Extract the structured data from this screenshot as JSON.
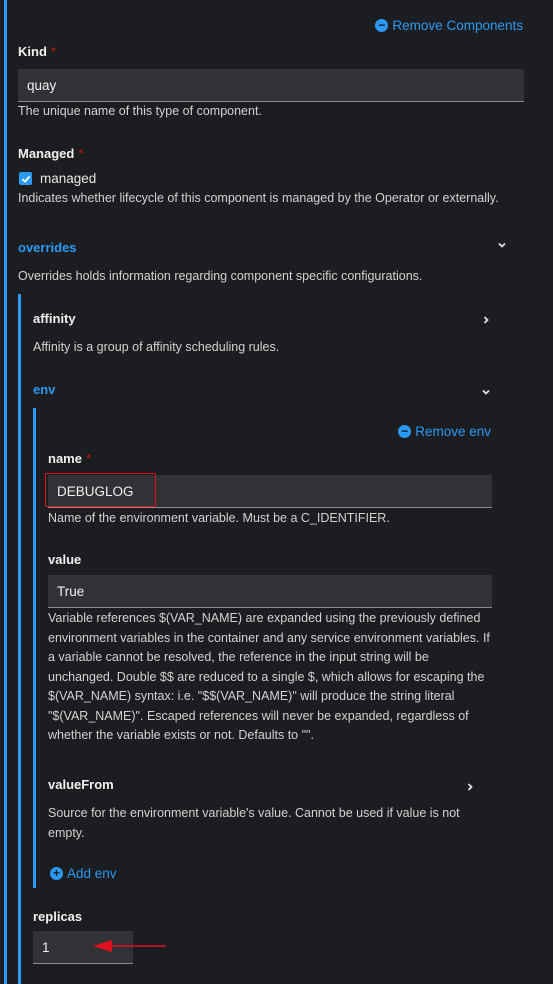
{
  "remove_components_label": "Remove Components",
  "kind": {
    "label": "Kind",
    "required": "*",
    "value": "quay",
    "help": "The unique name of this type of component."
  },
  "managed": {
    "label": "Managed",
    "required": "*",
    "checkbox_label": "managed",
    "checked": true,
    "help": "Indicates whether lifecycle of this component is managed by the Operator or externally."
  },
  "overrides": {
    "label": "overrides",
    "help": "Overrides holds information regarding component specific configurations.",
    "affinity": {
      "label": "affinity",
      "help": "Affinity is a group of affinity scheduling rules."
    },
    "env": {
      "label": "env",
      "remove_label": "Remove env",
      "name": {
        "label": "name",
        "required": "*",
        "value": "DEBUGLOG",
        "help": "Name of the environment variable. Must be a C_IDENTIFIER."
      },
      "value": {
        "label": "value",
        "value": "True",
        "help": "Variable references $(VAR_NAME) are expanded using the previously defined environment variables in the container and any service environment variables. If a variable cannot be resolved, the reference in the input string will be unchanged. Double $$ are reduced to a single $, which allows for escaping the $(VAR_NAME) syntax: i.e. \"$$(VAR_NAME)\" will produce the string literal \"$(VAR_NAME)\". Escaped references will never be expanded, regardless of whether the variable exists or not. Defaults to \"\"."
      },
      "value_from": {
        "label": "valueFrom",
        "help": "Source for the environment variable's value. Cannot be used if value is not empty."
      },
      "add_label": "Add env"
    },
    "replicas": {
      "label": "replicas",
      "value": "1"
    }
  },
  "colors": {
    "accent": "#2b9af3",
    "required": "#c9190b",
    "highlight": "#e0111c"
  },
  "icons": {
    "remove": "minus-circle-icon",
    "add": "plus-circle-icon",
    "expanded": "chevron-down-icon",
    "collapsed": "chevron-right-icon",
    "checked": "check-icon"
  }
}
